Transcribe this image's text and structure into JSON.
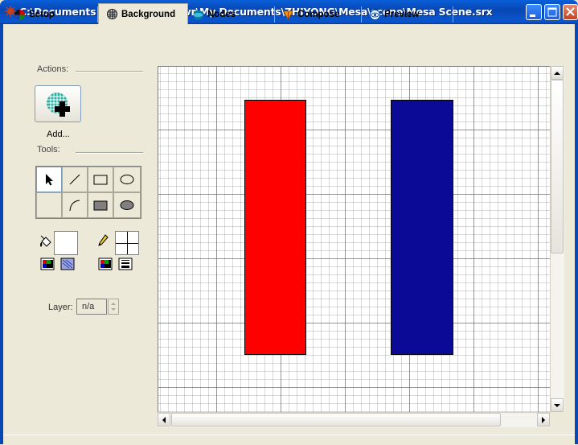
{
  "window": {
    "title": "C:\\Documents and Settings\\qtvr\\My Documents\\ZHIYONG\\Mesa\\scene\\Mesa Scene.srx",
    "controls": [
      "minimize-icon",
      "maximize-icon",
      "close-icon"
    ]
  },
  "tabs": [
    {
      "label": "Setup",
      "icon": "setup-icon",
      "active": false
    },
    {
      "label": "Background",
      "icon": "grid-icon",
      "active": true
    },
    {
      "label": "Nodes",
      "icon": "nodes-icon",
      "active": false
    },
    {
      "label": "Compose",
      "icon": "compose-icon",
      "active": false
    },
    {
      "label": "Preview",
      "icon": "eye-icon",
      "active": false
    }
  ],
  "actions": {
    "header": "Actions:",
    "add_label": "Add..."
  },
  "tools": {
    "header": "Tools:",
    "items": [
      "arrow-icon",
      "line-icon",
      "rectangle-icon",
      "ellipse-icon",
      "blank",
      "arc-icon",
      "filled-rectangle-icon",
      "filled-ellipse-icon"
    ]
  },
  "colors": {
    "fill_color": "#ffffff",
    "pen_color": "#ffffff"
  },
  "layer": {
    "label": "Layer:",
    "value": "n/a"
  },
  "canvas": {
    "shapes": [
      {
        "name": "red-rectangle",
        "fill": "#ff0000"
      },
      {
        "name": "blue-rectangle",
        "fill": "#0a0a96"
      }
    ]
  }
}
